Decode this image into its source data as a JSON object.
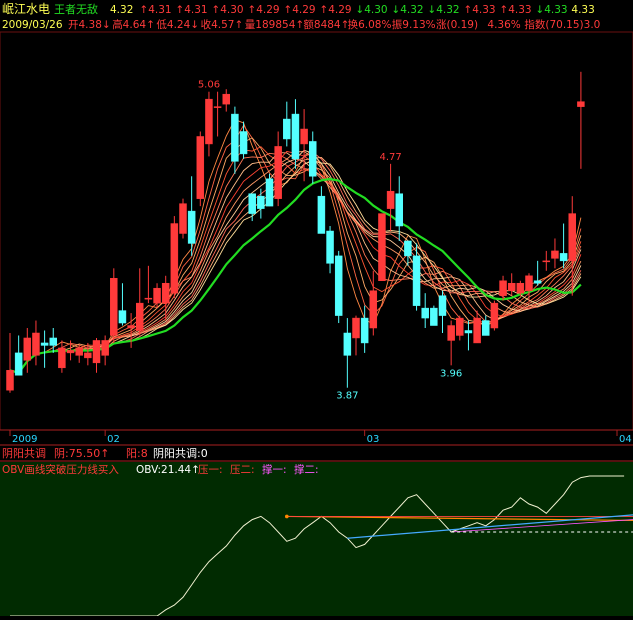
{
  "header": {
    "stock_name": "岷江水电",
    "mode": "王者无敌",
    "ticker_values": [
      {
        "v": "4.32",
        "dir": "none"
      },
      {
        "v": "4.31",
        "dir": "up"
      },
      {
        "v": "4.31",
        "dir": "up"
      },
      {
        "v": "4.30",
        "dir": "up"
      },
      {
        "v": "4.29",
        "dir": "up"
      },
      {
        "v": "4.29",
        "dir": "up"
      },
      {
        "v": "4.29",
        "dir": "up"
      },
      {
        "v": "4.30",
        "dir": "down"
      },
      {
        "v": "4.32",
        "dir": "down"
      },
      {
        "v": "4.32",
        "dir": "down"
      },
      {
        "v": "4.33",
        "dir": "up"
      },
      {
        "v": "4.33",
        "dir": "up"
      },
      {
        "v": "4.33",
        "dir": "down"
      },
      {
        "v": "4.33",
        "dir": "none"
      }
    ],
    "date": "2009/03/26",
    "stats": [
      {
        "label": "开",
        "value": "4.38",
        "dir": "down"
      },
      {
        "label": "高",
        "value": "4.64",
        "dir": "up"
      },
      {
        "label": "低",
        "value": "4.24",
        "dir": "down"
      },
      {
        "label": "收",
        "value": "4.57",
        "dir": "up"
      },
      {
        "label": "量",
        "value": "189854",
        "dir": "up"
      },
      {
        "label": "额",
        "value": "8484",
        "dir": "up"
      },
      {
        "label": "换",
        "value": "6.08%",
        "dir": "none"
      },
      {
        "label": "振",
        "value": "9.13%",
        "dir": "none"
      },
      {
        "label": "涨",
        "value": "(0.19)",
        "dir": "none"
      },
      {
        "label": "",
        "value": "4.36%",
        "dir": "none"
      },
      {
        "label": "指数",
        "value": "(70.15)3.0",
        "dir": "none"
      }
    ]
  },
  "colors": {
    "up": "#ff3a3a",
    "down": "#54ffff",
    "header_text": "#ffff54",
    "label_text": "#ff3a3a",
    "ma_green": "#22dd22",
    "grid": "#6a1010",
    "axis_text": "#2ad6ff",
    "obv_bg": "#012b01"
  },
  "chart_data": [
    {
      "type": "candlestick",
      "title": "",
      "ylim": [
        3.7,
        5.3
      ],
      "x_ticks": [
        {
          "label": "2009",
          "index": 0
        },
        {
          "label": "02",
          "index": 11
        },
        {
          "label": "03",
          "index": 41
        },
        {
          "label": "04",
          "index": 71
        }
      ],
      "annotations": [
        {
          "text": "5.06",
          "index": 23,
          "value": 5.06,
          "pos": "above"
        },
        {
          "text": "4.77",
          "index": 44,
          "value": 4.77,
          "pos": "above"
        },
        {
          "text": "3.87",
          "index": 39,
          "value": 3.87,
          "pos": "below"
        },
        {
          "text": "3.96",
          "index": 51,
          "value": 3.96,
          "pos": "below"
        }
      ],
      "candles": [
        {
          "o": 3.86,
          "h": 4.09,
          "l": 3.85,
          "c": 3.94
        },
        {
          "o": 4.01,
          "h": 4.08,
          "l": 3.92,
          "c": 3.92
        },
        {
          "o": 3.98,
          "h": 4.11,
          "l": 3.93,
          "c": 4.07
        },
        {
          "o": 4.0,
          "h": 4.14,
          "l": 3.96,
          "c": 4.09
        },
        {
          "o": 4.05,
          "h": 4.1,
          "l": 3.95,
          "c": 4.04
        },
        {
          "o": 4.07,
          "h": 4.11,
          "l": 4.01,
          "c": 4.04
        },
        {
          "o": 3.95,
          "h": 4.06,
          "l": 3.93,
          "c": 4.03
        },
        {
          "o": 4.01,
          "h": 4.06,
          "l": 3.98,
          "c": 4.02
        },
        {
          "o": 4.0,
          "h": 4.04,
          "l": 3.97,
          "c": 4.03
        },
        {
          "o": 3.99,
          "h": 4.05,
          "l": 3.96,
          "c": 4.01
        },
        {
          "o": 3.97,
          "h": 4.07,
          "l": 3.93,
          "c": 4.06
        },
        {
          "o": 4.0,
          "h": 4.08,
          "l": 3.96,
          "c": 4.06
        },
        {
          "o": 4.08,
          "h": 4.35,
          "l": 4.05,
          "c": 4.31
        },
        {
          "o": 4.18,
          "h": 4.29,
          "l": 4.12,
          "c": 4.13
        },
        {
          "o": 4.11,
          "h": 4.17,
          "l": 4.03,
          "c": 4.12
        },
        {
          "o": 4.1,
          "h": 4.35,
          "l": 4.08,
          "c": 4.21
        },
        {
          "o": 4.23,
          "h": 4.36,
          "l": 4.21,
          "c": 4.23
        },
        {
          "o": 4.21,
          "h": 4.29,
          "l": 4.19,
          "c": 4.27
        },
        {
          "o": 4.21,
          "h": 4.32,
          "l": 4.14,
          "c": 4.29
        },
        {
          "o": 4.25,
          "h": 4.56,
          "l": 4.23,
          "c": 4.53
        },
        {
          "o": 4.49,
          "h": 4.63,
          "l": 4.47,
          "c": 4.61
        },
        {
          "o": 4.58,
          "h": 4.72,
          "l": 4.4,
          "c": 4.45
        },
        {
          "o": 4.63,
          "h": 4.9,
          "l": 4.6,
          "c": 4.88
        },
        {
          "o": 4.85,
          "h": 5.06,
          "l": 4.8,
          "c": 5.03
        },
        {
          "o": 5.0,
          "h": 5.06,
          "l": 4.88,
          "c": 5.0
        },
        {
          "o": 5.01,
          "h": 5.07,
          "l": 4.98,
          "c": 5.05
        },
        {
          "o": 4.97,
          "h": 5.0,
          "l": 4.73,
          "c": 4.78
        },
        {
          "o": 4.9,
          "h": 4.94,
          "l": 4.79,
          "c": 4.81
        },
        {
          "o": 4.65,
          "h": 4.65,
          "l": 4.54,
          "c": 4.57
        },
        {
          "o": 4.64,
          "h": 4.67,
          "l": 4.55,
          "c": 4.59
        },
        {
          "o": 4.71,
          "h": 4.73,
          "l": 4.6,
          "c": 4.6
        },
        {
          "o": 4.63,
          "h": 4.9,
          "l": 4.6,
          "c": 4.84
        },
        {
          "o": 4.95,
          "h": 5.02,
          "l": 4.84,
          "c": 4.87
        },
        {
          "o": 4.97,
          "h": 5.03,
          "l": 4.75,
          "c": 4.79
        },
        {
          "o": 4.85,
          "h": 4.99,
          "l": 4.7,
          "c": 4.91
        },
        {
          "o": 4.86,
          "h": 4.9,
          "l": 4.69,
          "c": 4.72
        },
        {
          "o": 4.64,
          "h": 4.68,
          "l": 4.49,
          "c": 4.49
        },
        {
          "o": 4.5,
          "h": 4.52,
          "l": 4.33,
          "c": 4.37
        },
        {
          "o": 4.4,
          "h": 4.42,
          "l": 4.13,
          "c": 4.16
        },
        {
          "o": 4.09,
          "h": 4.15,
          "l": 3.87,
          "c": 4.0
        },
        {
          "o": 4.07,
          "h": 4.16,
          "l": 4.0,
          "c": 4.15
        },
        {
          "o": 4.15,
          "h": 4.2,
          "l": 4.01,
          "c": 4.05
        },
        {
          "o": 4.11,
          "h": 4.34,
          "l": 4.08,
          "c": 4.26
        },
        {
          "o": 4.3,
          "h": 4.57,
          "l": 4.3,
          "c": 4.57
        },
        {
          "o": 4.59,
          "h": 4.77,
          "l": 4.5,
          "c": 4.66
        },
        {
          "o": 4.65,
          "h": 4.72,
          "l": 4.46,
          "c": 4.52
        },
        {
          "o": 4.46,
          "h": 4.46,
          "l": 4.36,
          "c": 4.4
        },
        {
          "o": 4.4,
          "h": 4.45,
          "l": 4.18,
          "c": 4.2
        },
        {
          "o": 4.19,
          "h": 4.25,
          "l": 4.11,
          "c": 4.15
        },
        {
          "o": 4.19,
          "h": 4.2,
          "l": 4.12,
          "c": 4.12
        },
        {
          "o": 4.24,
          "h": 4.26,
          "l": 4.09,
          "c": 4.16
        },
        {
          "o": 4.06,
          "h": 4.14,
          "l": 3.96,
          "c": 4.12
        },
        {
          "o": 4.08,
          "h": 4.16,
          "l": 4.06,
          "c": 4.15
        },
        {
          "o": 4.1,
          "h": 4.14,
          "l": 4.02,
          "c": 4.09
        },
        {
          "o": 4.05,
          "h": 4.18,
          "l": 4.05,
          "c": 4.15
        },
        {
          "o": 4.14,
          "h": 4.16,
          "l": 4.08,
          "c": 4.08
        },
        {
          "o": 4.11,
          "h": 4.22,
          "l": 4.1,
          "c": 4.21
        },
        {
          "o": 4.24,
          "h": 4.32,
          "l": 4.22,
          "c": 4.3
        },
        {
          "o": 4.26,
          "h": 4.33,
          "l": 4.24,
          "c": 4.29
        },
        {
          "o": 4.25,
          "h": 4.3,
          "l": 4.24,
          "c": 4.29
        },
        {
          "o": 4.26,
          "h": 4.33,
          "l": 4.22,
          "c": 4.32
        },
        {
          "o": 4.3,
          "h": 4.38,
          "l": 4.28,
          "c": 4.29
        },
        {
          "o": 4.38,
          "h": 4.42,
          "l": 4.34,
          "c": 4.38
        },
        {
          "o": 4.39,
          "h": 4.47,
          "l": 4.35,
          "c": 4.42
        },
        {
          "o": 4.41,
          "h": 4.53,
          "l": 4.35,
          "c": 4.38
        },
        {
          "o": 4.38,
          "h": 4.64,
          "l": 4.24,
          "c": 4.57
        },
        {
          "o": 5.0,
          "h": 5.14,
          "l": 4.75,
          "c": 5.02
        }
      ]
    },
    {
      "type": "text",
      "title": "阴阳共调",
      "values": [
        {
          "label": "阴",
          "value": "75.50",
          "dir": "up"
        },
        {
          "label": "阳",
          "value": "8",
          "dir": "none"
        },
        {
          "label": "阴阳共调",
          "value": "0",
          "dir": "none"
        }
      ]
    },
    {
      "type": "line",
      "title": "OBV画线突破压力线买入",
      "legend": [
        {
          "name": "OBV",
          "value": "21.44",
          "color": "#ffffff",
          "dir": "up"
        },
        {
          "name": "压一",
          "color": "#ff3a3a"
        },
        {
          "name": "压二",
          "color": "#ff3a3a"
        },
        {
          "name": "撑一",
          "color": "#ff55ff"
        },
        {
          "name": "撑二",
          "color": "#ff55ff"
        }
      ],
      "ylim": [
        -40,
        50
      ],
      "obv": [
        -40,
        -40,
        -40,
        -40,
        -40,
        -40,
        -40,
        -40,
        -40,
        -40,
        -40,
        -40,
        -40,
        -40,
        -40,
        -40,
        -40,
        -40,
        -36,
        -33,
        -28,
        -20,
        -12,
        -5,
        0,
        5,
        12,
        18,
        22,
        24,
        20,
        14,
        8,
        10,
        16,
        20,
        24,
        20,
        14,
        10,
        4,
        6,
        12,
        18,
        24,
        30,
        36,
        38,
        32,
        26,
        20,
        14,
        16,
        18,
        20,
        18,
        22,
        28,
        30,
        36,
        32,
        30,
        26,
        32,
        38,
        46,
        49,
        50,
        50,
        50,
        50,
        50
      ]
    }
  ]
}
